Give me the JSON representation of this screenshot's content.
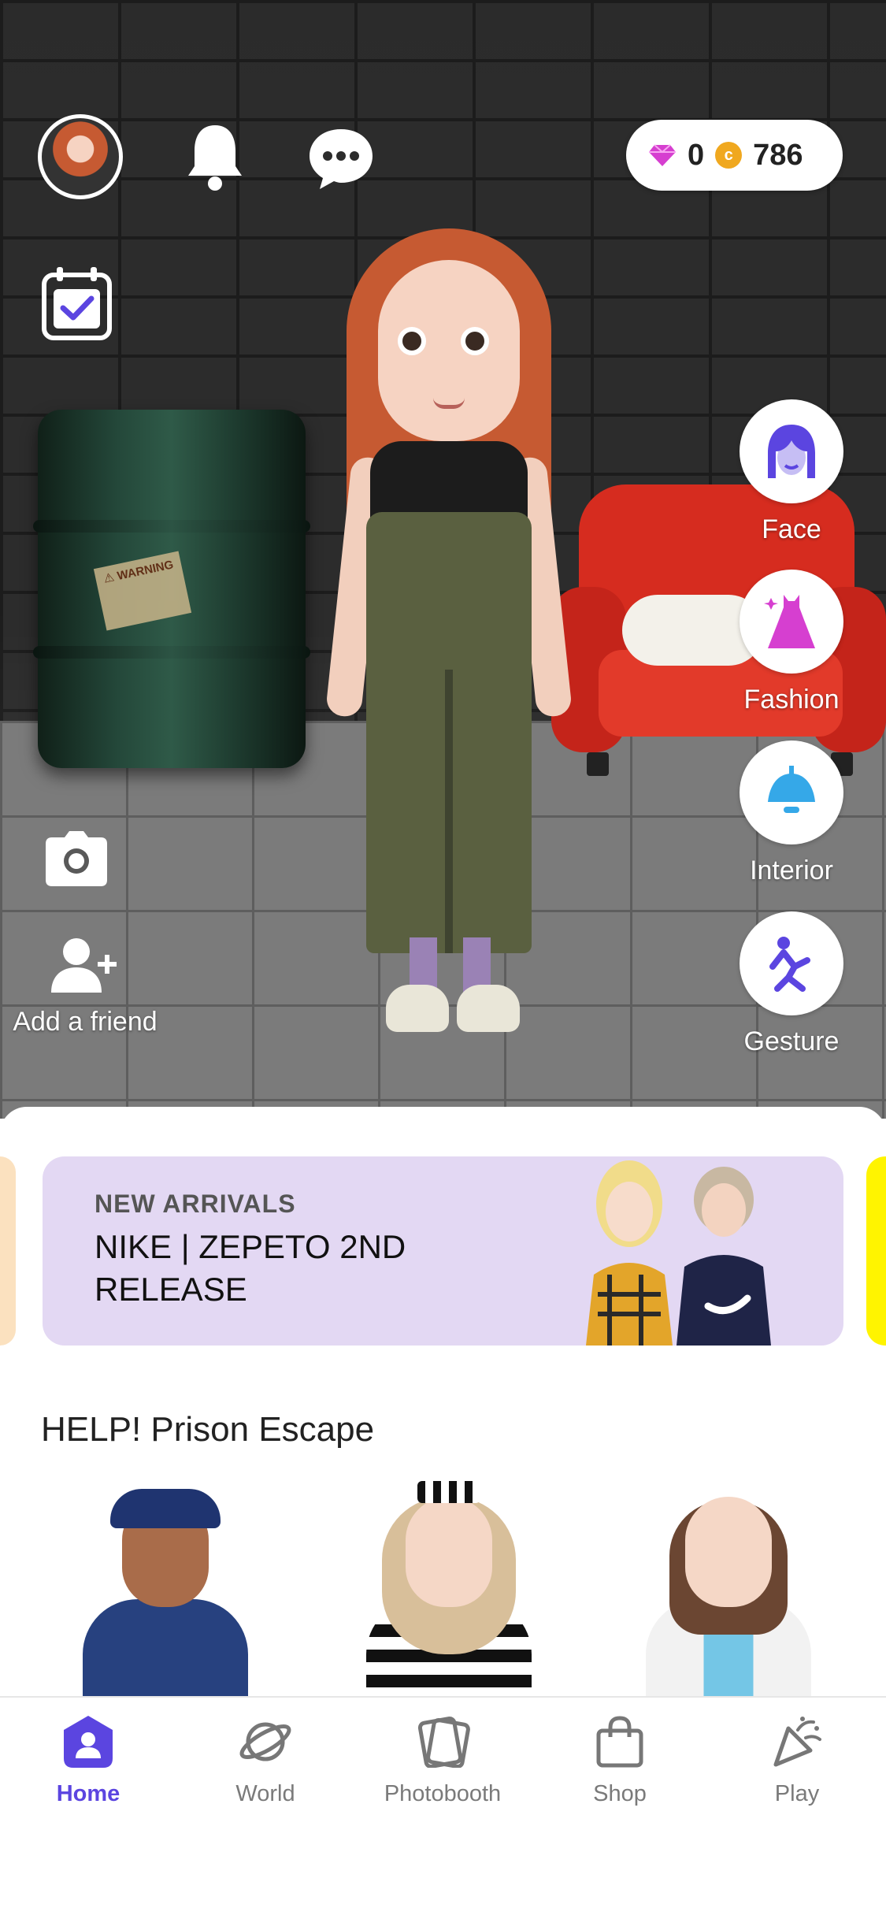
{
  "topbar": {
    "gems": "0",
    "coins": "786",
    "coin_symbol": "c"
  },
  "side_menu": [
    {
      "label": "Face",
      "icon": "face-icon"
    },
    {
      "label": "Fashion",
      "icon": "dress-icon"
    },
    {
      "label": "Interior",
      "icon": "lamp-icon"
    },
    {
      "label": "Gesture",
      "icon": "gesture-icon"
    }
  ],
  "left_actions": {
    "add_friend_label": "Add a friend"
  },
  "banner": {
    "kicker": "NEW ARRIVALS",
    "title": "NIKE | ZEPETO 2ND RELEASE"
  },
  "section": {
    "title": "HELP! Prison Escape"
  },
  "bottom_nav": [
    {
      "label": "Home",
      "active": true
    },
    {
      "label": "World",
      "active": false
    },
    {
      "label": "Photobooth",
      "active": false
    },
    {
      "label": "Shop",
      "active": false
    },
    {
      "label": "Play",
      "active": false
    }
  ],
  "colors": {
    "accent": "#5b45e0",
    "banner_bg": "#e3d8f3"
  }
}
